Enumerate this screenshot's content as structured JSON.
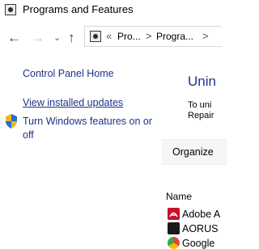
{
  "window": {
    "title": "Programs and Features",
    "title_icon": "control-panel-icon"
  },
  "nav": {
    "back_icon": "back-arrow-icon",
    "forward_icon": "forward-arrow-icon",
    "recent_icon": "chevron-down-icon",
    "up_icon": "up-arrow-icon",
    "overflow": "«",
    "breadcrumb": [
      "Pro...",
      "Progra..."
    ],
    "separator": ">"
  },
  "left_pane": {
    "heading": "Control Panel Home",
    "link": "View installed updates",
    "task": "Turn Windows features on or off",
    "task_icon": "shield-icon"
  },
  "main": {
    "title": "Unin",
    "desc_lines": [
      "To uni",
      "Repair"
    ]
  },
  "toolbar": {
    "organize_label": "Organize"
  },
  "list": {
    "column": "Name",
    "items": [
      {
        "name": "Adobe A",
        "icon": "adobe-acrobat-icon",
        "color": "#c8102e"
      },
      {
        "name": "AORUS",
        "icon": "aorus-icon",
        "color": "#1a1a1a"
      },
      {
        "name": "Google",
        "icon": "chrome-icon",
        "color": "#4285f4"
      }
    ]
  },
  "colors": {
    "link_blue": "#1e3287",
    "toolbar_bg": "#f5f6f7"
  }
}
